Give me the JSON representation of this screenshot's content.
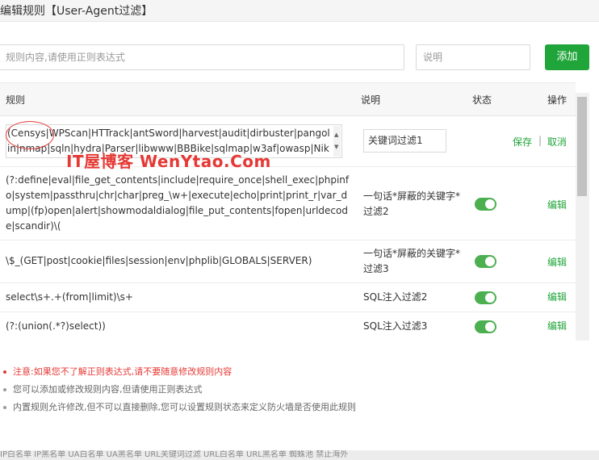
{
  "dialog": {
    "title": "编辑规则【User-Agent过滤】"
  },
  "form": {
    "rule_placeholder": "规则内容,请使用正则表达式",
    "desc_placeholder": "说明",
    "add_label": "添加"
  },
  "table": {
    "headers": {
      "rule": "规则",
      "desc": "说明",
      "status": "状态",
      "ops": "操作"
    },
    "editing_row": {
      "rule_value": "(Censys|WPScan|HTTrack|antSword|harvest|audit|dirbuster|pangolin|nmap|sqln|hydra|Parser|libwww|BBBike|sqlmap|w3af|owasp|Nikto",
      "desc_value": "关键词过滤1",
      "save_label": "保存",
      "separator": "|",
      "cancel_label": "取消"
    },
    "rows": [
      {
        "rule": "(?:define|eval|file_get_contents|include|require_once|shell_exec|phpinfo|system|passthru|chr|char|preg_\\w+|execute|echo|print|print_r|var_dump|(fp)open|alert|showmodaldialog|file_put_contents|fopen|urldecode|scandir)\\(",
        "desc": "一句话*屏蔽的关键字*过滤2",
        "status": true,
        "op": "编辑"
      },
      {
        "rule": "\\$_(GET|post|cookie|files|session|env|phplib|GLOBALS|SERVER)",
        "desc": "一句话*屏蔽的关键字*过滤3",
        "status": true,
        "op": "编辑"
      },
      {
        "rule": "select\\s+.+(from|limit)\\s+",
        "desc": "SQL注入过滤2",
        "status": true,
        "op": "编辑"
      },
      {
        "rule": "(?:(union(.*?)select))",
        "desc": "SQL注入过滤3",
        "status": true,
        "op": "编辑"
      }
    ]
  },
  "watermark": "IT屋博客 WenYtao.Com",
  "notes": [
    "注意:如果您不了解正则表达式,请不要随意修改规则内容",
    "您可以添加或修改规则内容,但请使用正则表达式",
    "内置规则允许修改,但不可以直接删除,您可以设置规则状态来定义防火墙是否使用此规则"
  ],
  "bottom_strip": "IP白名单  IP黑名单  UA白名单  UA黑名单  URL关键词过滤  URL白名单  URL黑名单  蜘蛛池  禁止海外"
}
